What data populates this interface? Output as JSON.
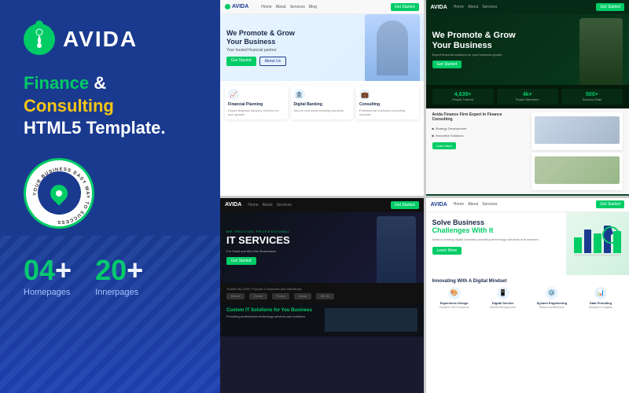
{
  "brand": {
    "name": "AVIDA",
    "logo_symbol": "◈"
  },
  "left": {
    "tagline_finance": "Finance",
    "tagline_amp": " & ",
    "tagline_consulting": "Consulting",
    "tagline_html5": "HTML5 Template.",
    "badge_text": "YOUR BUSINESS EASY WAY TO SUCCESS",
    "stats": [
      {
        "number": "04+",
        "label": "Homepages"
      },
      {
        "number": "20+",
        "label": "Innerpages"
      }
    ]
  },
  "screenshots": {
    "ss1": {
      "nav_logo": "AVIDA",
      "hero_title": "We Promote & Grow\nYour Business",
      "hero_subtitle": "Your trusted financial partner",
      "btn_get_started": "Get Started",
      "btn_about": "About Us",
      "cards": [
        {
          "icon": "📈",
          "title": "Financial Planning",
          "desc": "Expert financial advisory services for your growth"
        },
        {
          "icon": "🏦",
          "title": "Digital Banking",
          "desc": "Secure and smart banking solutions"
        },
        {
          "icon": "💼",
          "title": "Consulting",
          "desc": "Professional business consulting services"
        }
      ]
    },
    "ss2": {
      "nav_logo": "AVIDA",
      "label": "WE PROVIDE PROFESSIONAL",
      "hero_title": "IT SERVICES",
      "hero_subtitle": "For Small and Mid-Size Businesses",
      "trusted_by": "Trusted By 1000+ Popular Companies and Individuals",
      "it_section_title": "Custom IT Solutions for You Business",
      "it_section_desc": "Providing professional technology services and solutions",
      "logos": [
        "Desco",
        "Canal",
        "Forsa",
        "Axela",
        "BK-41"
      ]
    },
    "ss3": {
      "nav_logo": "AVIDA",
      "hero_title": "We Promote & Grow\nYour Business",
      "btn_get_started": "Get Started",
      "stats": [
        {
          "number": "4,639+",
          "label": "People Trained"
        },
        {
          "number": "4k+",
          "label": "Expert Members"
        },
        {
          "number": "500+",
          "label": "Success Rate"
        }
      ],
      "service_label": "Avida Finance Firm Expert In Finance Consulting",
      "services": [
        {
          "title": "Strategy Development"
        },
        {
          "title": "Innovative Solutions"
        }
      ]
    },
    "ss4": {
      "nav_logo": "AVIDA",
      "hero_title": "Solve Business",
      "hero_title_highlight": "Challenges With It",
      "hero_desc": "Avida is leading digital company providing technology solutions and services.",
      "btn_learn": "Learn More",
      "bottom_title": "Innovating With A Digital Mindset",
      "features": [
        {
          "icon": "🎨",
          "title": "Experience Design",
          "desc": "Creative UI/UX solutions"
        },
        {
          "icon": "📱",
          "title": "Digital Service",
          "desc": "Mobile-first approach"
        },
        {
          "icon": "⚙️",
          "title": "System Engineering",
          "desc": "Robust architectures"
        },
        {
          "icon": "📊",
          "title": "Data Providing",
          "desc": "Analytics & insights"
        }
      ]
    }
  }
}
